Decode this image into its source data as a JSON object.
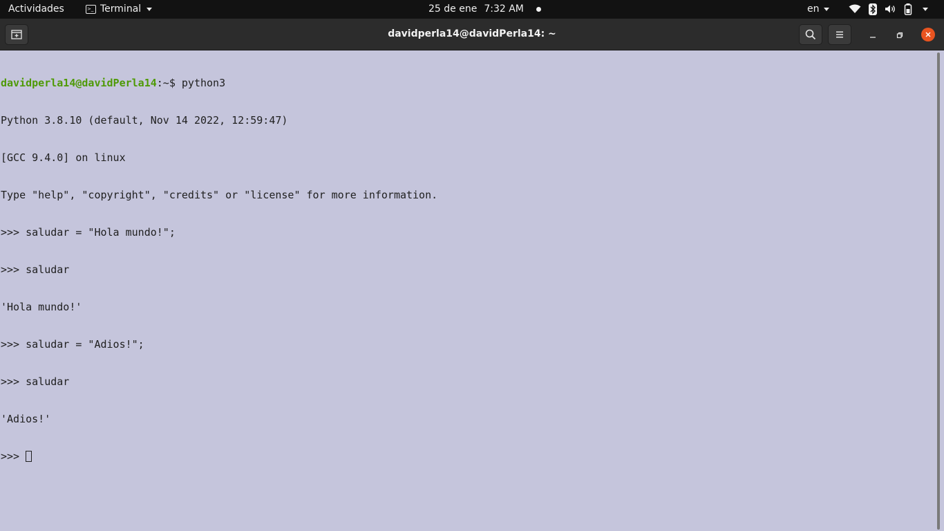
{
  "topbar": {
    "activities": "Actividades",
    "app_name": "Terminal",
    "date": "25 de ene",
    "time": "7:32 AM",
    "language": "en",
    "tray_icons": [
      "wifi-icon",
      "bluetooth-icon",
      "volume-icon",
      "battery-icon",
      "system-menu-caret-icon"
    ]
  },
  "window": {
    "title": "davidperla14@davidPerla14: ~"
  },
  "terminal": {
    "prompt_user": "davidperla14@davidPerla14",
    "prompt_path": ":~$ ",
    "command": "python3",
    "lines": [
      "Python 3.8.10 (default, Nov 14 2022, 12:59:47)",
      "[GCC 9.4.0] on linux",
      "Type \"help\", \"copyright\", \"credits\" or \"license\" for more information.",
      ">>> saludar = \"Hola mundo!\";",
      ">>> saludar",
      "'Hola mundo!'",
      ">>> saludar = \"Adios!\";",
      ">>> saludar",
      "'Adios!'"
    ],
    "current_prompt": ">>> "
  },
  "colors": {
    "terminal_bg": "#c5c5dc",
    "prompt_green": "#4e9a06",
    "close_orange": "#e95420",
    "topbar_bg": "#121212",
    "headerbar_bg": "#2c2c2c"
  }
}
